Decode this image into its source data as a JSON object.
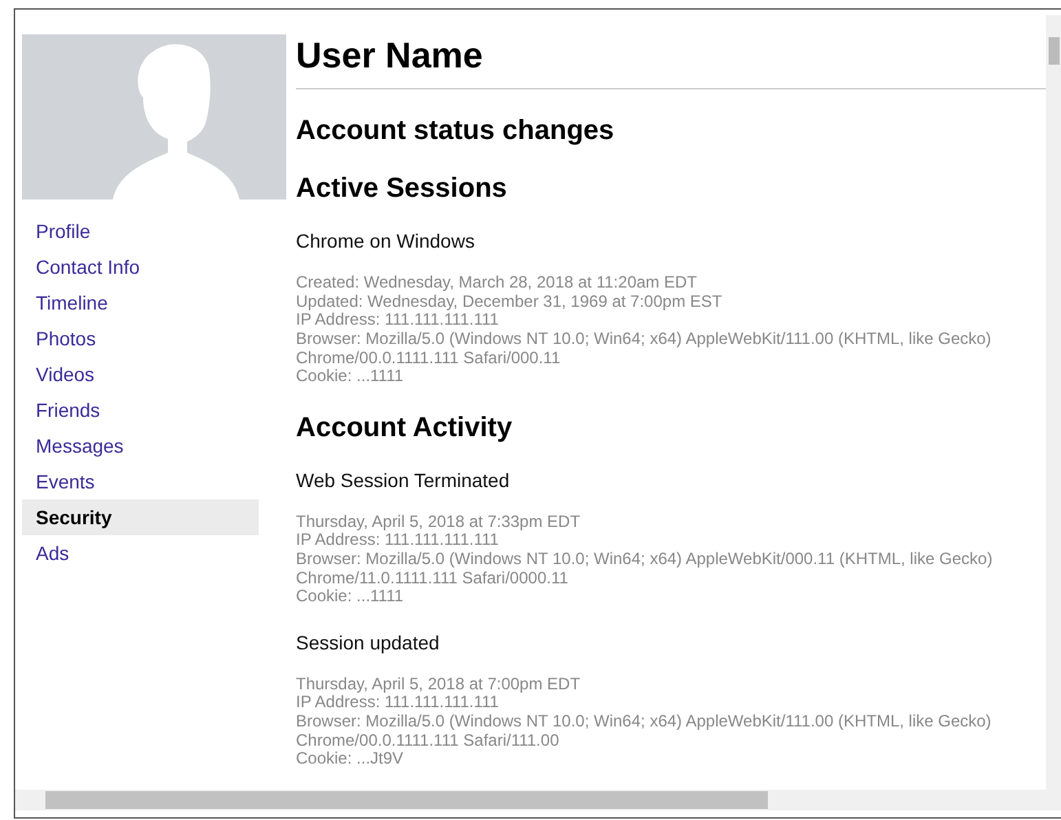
{
  "user_name": "User Name",
  "sidebar": {
    "items": [
      {
        "label": "Profile",
        "selected": false
      },
      {
        "label": "Contact Info",
        "selected": false
      },
      {
        "label": "Timeline",
        "selected": false
      },
      {
        "label": "Photos",
        "selected": false
      },
      {
        "label": "Videos",
        "selected": false
      },
      {
        "label": "Friends",
        "selected": false
      },
      {
        "label": "Messages",
        "selected": false
      },
      {
        "label": "Events",
        "selected": false
      },
      {
        "label": "Security",
        "selected": true
      },
      {
        "label": "Ads",
        "selected": false
      }
    ]
  },
  "sections": [
    {
      "heading": "Account status changes"
    },
    {
      "heading": "Active Sessions",
      "entries": [
        {
          "title": "Chrome on Windows",
          "details": [
            "Created: Wednesday, March 28, 2018 at 11:20am EDT",
            "Updated: Wednesday, December 31, 1969 at 7:00pm EST",
            "IP Address: 111.111.111.111",
            "Browser: Mozilla/5.0 (Windows NT 10.0; Win64; x64) AppleWebKit/111.00 (KHTML, like Gecko)",
            "Chrome/00.0.1111.111 Safari/000.11",
            "Cookie: ...1111"
          ]
        }
      ]
    },
    {
      "heading": "Account Activity",
      "entries": [
        {
          "title": "Web Session Terminated",
          "details": [
            "Thursday, April 5, 2018 at 7:33pm EDT",
            "IP Address: 111.111.111.111",
            "Browser: Mozilla/5.0 (Windows NT 10.0; Win64; x64) AppleWebKit/000.11 (KHTML, like Gecko)",
            "Chrome/11.0.1111.111 Safari/0000.11",
            "Cookie: ...1111"
          ]
        },
        {
          "title": "Session updated",
          "details": [
            "Thursday, April 5, 2018 at 7:00pm EDT",
            "IP Address: 111.111.111.111",
            "Browser: Mozilla/5.0 (Windows NT 10.0; Win64; x64) AppleWebKit/111.00 (KHTML, like Gecko)",
            "Chrome/00.0.1111.111 Safari/111.00",
            "Cookie: ...Jt9V"
          ]
        }
      ]
    }
  ]
}
